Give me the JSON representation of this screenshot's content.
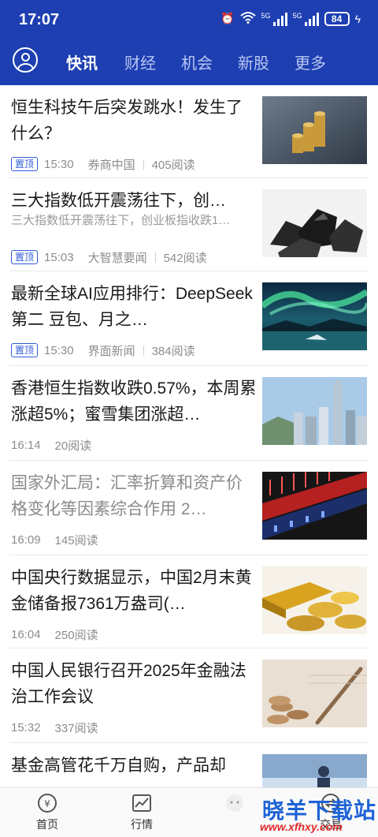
{
  "status": {
    "time": "17:07",
    "battery": "84",
    "net1": "5G",
    "net2": "5G"
  },
  "nav": {
    "tabs": [
      "快讯",
      "财经",
      "机会",
      "新股",
      "更多"
    ],
    "active_index": 0
  },
  "news": [
    {
      "title": "恒生科技午后突发跳水！发生了什么？",
      "summary": "",
      "pinned": true,
      "badge": "置顶",
      "time": "15:30",
      "source": "券商中国",
      "reads": "405阅读",
      "image": "coins"
    },
    {
      "title": "三大指数低开震荡往下，创…",
      "summary": "三大指数低开震荡往下，创业板指收跌1…",
      "pinned": true,
      "badge": "置顶",
      "time": "15:03",
      "source": "大智慧要闻",
      "reads": "542阅读",
      "image": "coal"
    },
    {
      "title": "最新全球AI应用排行：DeepSeek第二 豆包、月之…",
      "summary": "",
      "pinned": true,
      "badge": "置顶",
      "time": "15:30",
      "source": "界面新闻",
      "reads": "384阅读",
      "image": "aurora"
    },
    {
      "title": "香港恒生指数收跌0.57%，本周累涨超5%；蜜雪集团涨超…",
      "summary": "",
      "pinned": false,
      "badge": "",
      "time": "16:14",
      "source": "",
      "reads": "20阅读",
      "image": "skyline"
    },
    {
      "title": "国家外汇局：汇率折算和资产价格变化等因素综合作用 2…",
      "summary": "",
      "pinned": false,
      "badge": "",
      "time": "16:09",
      "source": "",
      "reads": "145阅读",
      "image": "ticker",
      "read": true
    },
    {
      "title": "中国央行数据显示，中国2月末黄金储备报7361万盎司(…",
      "summary": "",
      "pinned": false,
      "badge": "",
      "time": "16:04",
      "source": "",
      "reads": "250阅读",
      "image": "gold"
    },
    {
      "title": "中国人民银行召开2025年金融法治工作会议",
      "summary": "",
      "pinned": false,
      "badge": "",
      "time": "15:32",
      "source": "",
      "reads": "337阅读",
      "image": "pen"
    },
    {
      "title": "基金高管花千万自购，产品却",
      "summary": "",
      "pinned": false,
      "badge": "",
      "time": "",
      "source": "",
      "reads": "",
      "image": "office"
    }
  ],
  "bottom_nav": [
    {
      "label": "首页",
      "icon": "home-icon"
    },
    {
      "label": "行情",
      "icon": "market-chart-icon"
    },
    {
      "label": "",
      "icon": "center-icon"
    },
    {
      "label": "交易",
      "icon": "trade-icon"
    }
  ],
  "watermark": {
    "text": "晓羊下载站",
    "url": "www.xfhxy.com"
  },
  "colors": {
    "brand": "#1d3fb2",
    "badge": "#2e5bd8"
  }
}
